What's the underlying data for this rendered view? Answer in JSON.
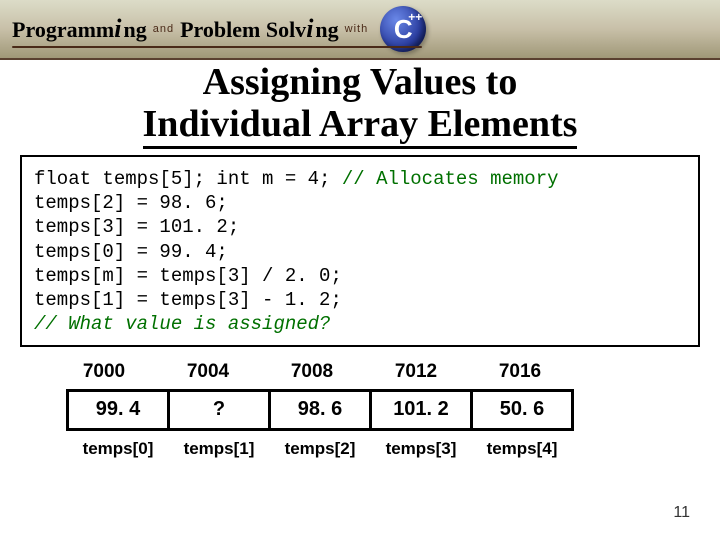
{
  "header": {
    "prog_prefix": "P",
    "prog_rest_italic_i": "rogramm",
    "prog_i": "i",
    "prog_end": "ng",
    "and": "and",
    "prob": "Problem Solv",
    "prob_i": "i",
    "prob_end": "ng",
    "with": "with",
    "cpp_c": "C",
    "cpp_pp": "++"
  },
  "title": {
    "line1": "Assigning Values to",
    "line2": "Individual Array Elements"
  },
  "code": {
    "l1a": "float temps[5]; int m = 4; ",
    "l1b": "// Allocates memory",
    "l2": "temps[2] = 98. 6;",
    "l3": "temps[3] = 101. 2;",
    "l4": "temps[0] = 99. 4;",
    "l5": "temps[m] = temps[3] / 2. 0;",
    "l6": "temps[1] = temps[3] - 1. 2;",
    "l7": "// What value is assigned?"
  },
  "array": {
    "addresses": [
      "7000",
      "7004",
      "7008",
      "7012",
      "7016"
    ],
    "values": [
      "99. 4",
      "?",
      "98. 6",
      "101. 2",
      "50. 6"
    ],
    "labels": [
      "temps[0]",
      "temps[1]",
      "temps[2]",
      "temps[3]",
      "temps[4]"
    ]
  },
  "slidenum": "11"
}
